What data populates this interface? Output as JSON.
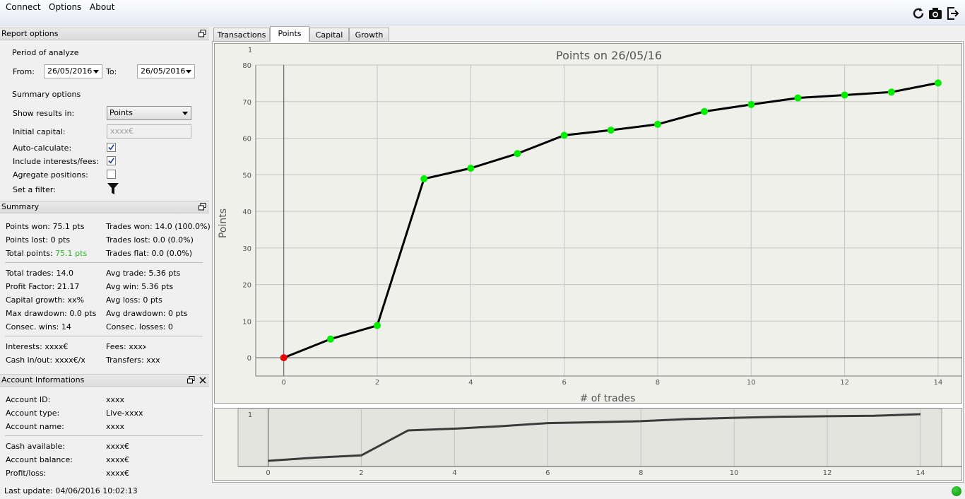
{
  "menu": {
    "connect": "Connect",
    "options": "Options",
    "about": "About"
  },
  "toolbar": {
    "icons": [
      "refresh-icon",
      "camera-icon",
      "export-icon"
    ]
  },
  "report_options": {
    "title": "Report options",
    "period_label": "Period of analyze",
    "from_label": "From:",
    "from_value": "26/05/2016",
    "to_label": "To:",
    "to_value": "26/05/2016",
    "summary_options_label": "Summary options",
    "show_results_label": "Show results in:",
    "show_results_value": "Points",
    "initial_capital_label": "Initial capital:",
    "initial_capital_placeholder": "xxxx€",
    "auto_calc_label": "Auto-calculate:",
    "auto_calc_checked": true,
    "include_fees_label": "Include interests/fees:",
    "include_fees_checked": true,
    "aggregate_label": "Agregate positions:",
    "aggregate_checked": false,
    "filter_label": "Set a filter:"
  },
  "summary": {
    "title": "Summary",
    "points_won": "Points won: 75.1 pts",
    "points_lost": "Points lost: 0 pts",
    "total_points_label": "Total points: ",
    "total_points_value": "75.1 pts",
    "trades_won": "Trades won: 14.0 (100.0%)",
    "trades_lost": "Trades lost: 0.0 (0.0%)",
    "trades_flat": "Trades flat: 0.0 (0.0%)",
    "total_trades": "Total trades: 14.0",
    "profit_factor": "Profit Factor: 21.17",
    "capital_growth": "Capital growth: xx%",
    "max_drawdown": "Max drawdown: 0.0 pts",
    "consec_wins": "Consec. wins: 14",
    "avg_trade": "Avg trade: 5.36 pts",
    "avg_win": "Avg win: 5.36 pts",
    "avg_loss": "Avg loss: 0 pts",
    "avg_drawdown": "Avg drawdown: 0 pts",
    "consec_losses": "Consec. losses: 0",
    "interests": "Interests: xxxx€",
    "cash_inout": "Cash in/out: xxxx€/xx",
    "fees": "Fees: xxxx",
    "transfers": "Transfers: xxxx"
  },
  "account": {
    "title": "Account Informations",
    "id_label": "Account ID:",
    "id_value": "xxxx",
    "type_label": "Account type:",
    "type_value": "Live-xxxx",
    "name_label": "Account name:",
    "name_value": "xxxx",
    "cash_label": "Cash available:",
    "cash_value": "xxxx€",
    "balance_label": "Account balance:",
    "balance_value": "xxxx€",
    "pl_label": "Profit/loss:",
    "pl_value": "xxxx€"
  },
  "status": {
    "last_update": "Last update: 04/06/2016 10:02:13"
  },
  "tabs": [
    {
      "label": "Transactions",
      "active": false
    },
    {
      "label": "Points",
      "active": true
    },
    {
      "label": "Capital",
      "active": false
    },
    {
      "label": "Growth",
      "active": false
    }
  ],
  "colors": {
    "accent_green": "#00ee00",
    "point_red": "#ee0000",
    "line": "#000000",
    "status_green": "#1aaa1a"
  },
  "chart_data": {
    "type": "line",
    "title": "Points on 26/05/16",
    "xlabel": "# of trades",
    "ylabel": "Points",
    "corner_label": "1",
    "x": [
      0,
      1,
      2,
      3,
      4,
      5,
      6,
      7,
      8,
      9,
      10,
      11,
      12,
      13,
      14
    ],
    "values": [
      0,
      5.1,
      8.8,
      48.9,
      51.8,
      55.8,
      60.8,
      62.2,
      63.8,
      67.3,
      69.2,
      71.0,
      71.8,
      72.6,
      75.1
    ],
    "xlim": [
      -0.6,
      14.5
    ],
    "ylim": [
      -5,
      80
    ],
    "x_ticks": [
      0,
      2,
      4,
      6,
      8,
      10,
      12,
      14
    ],
    "y_ticks": [
      0,
      10,
      20,
      30,
      40,
      50,
      60,
      70,
      80
    ],
    "grid": true
  },
  "overview_chart": {
    "corner_label": "1",
    "x_ticks": [
      0,
      2,
      4,
      6,
      8,
      10,
      12,
      14
    ]
  }
}
